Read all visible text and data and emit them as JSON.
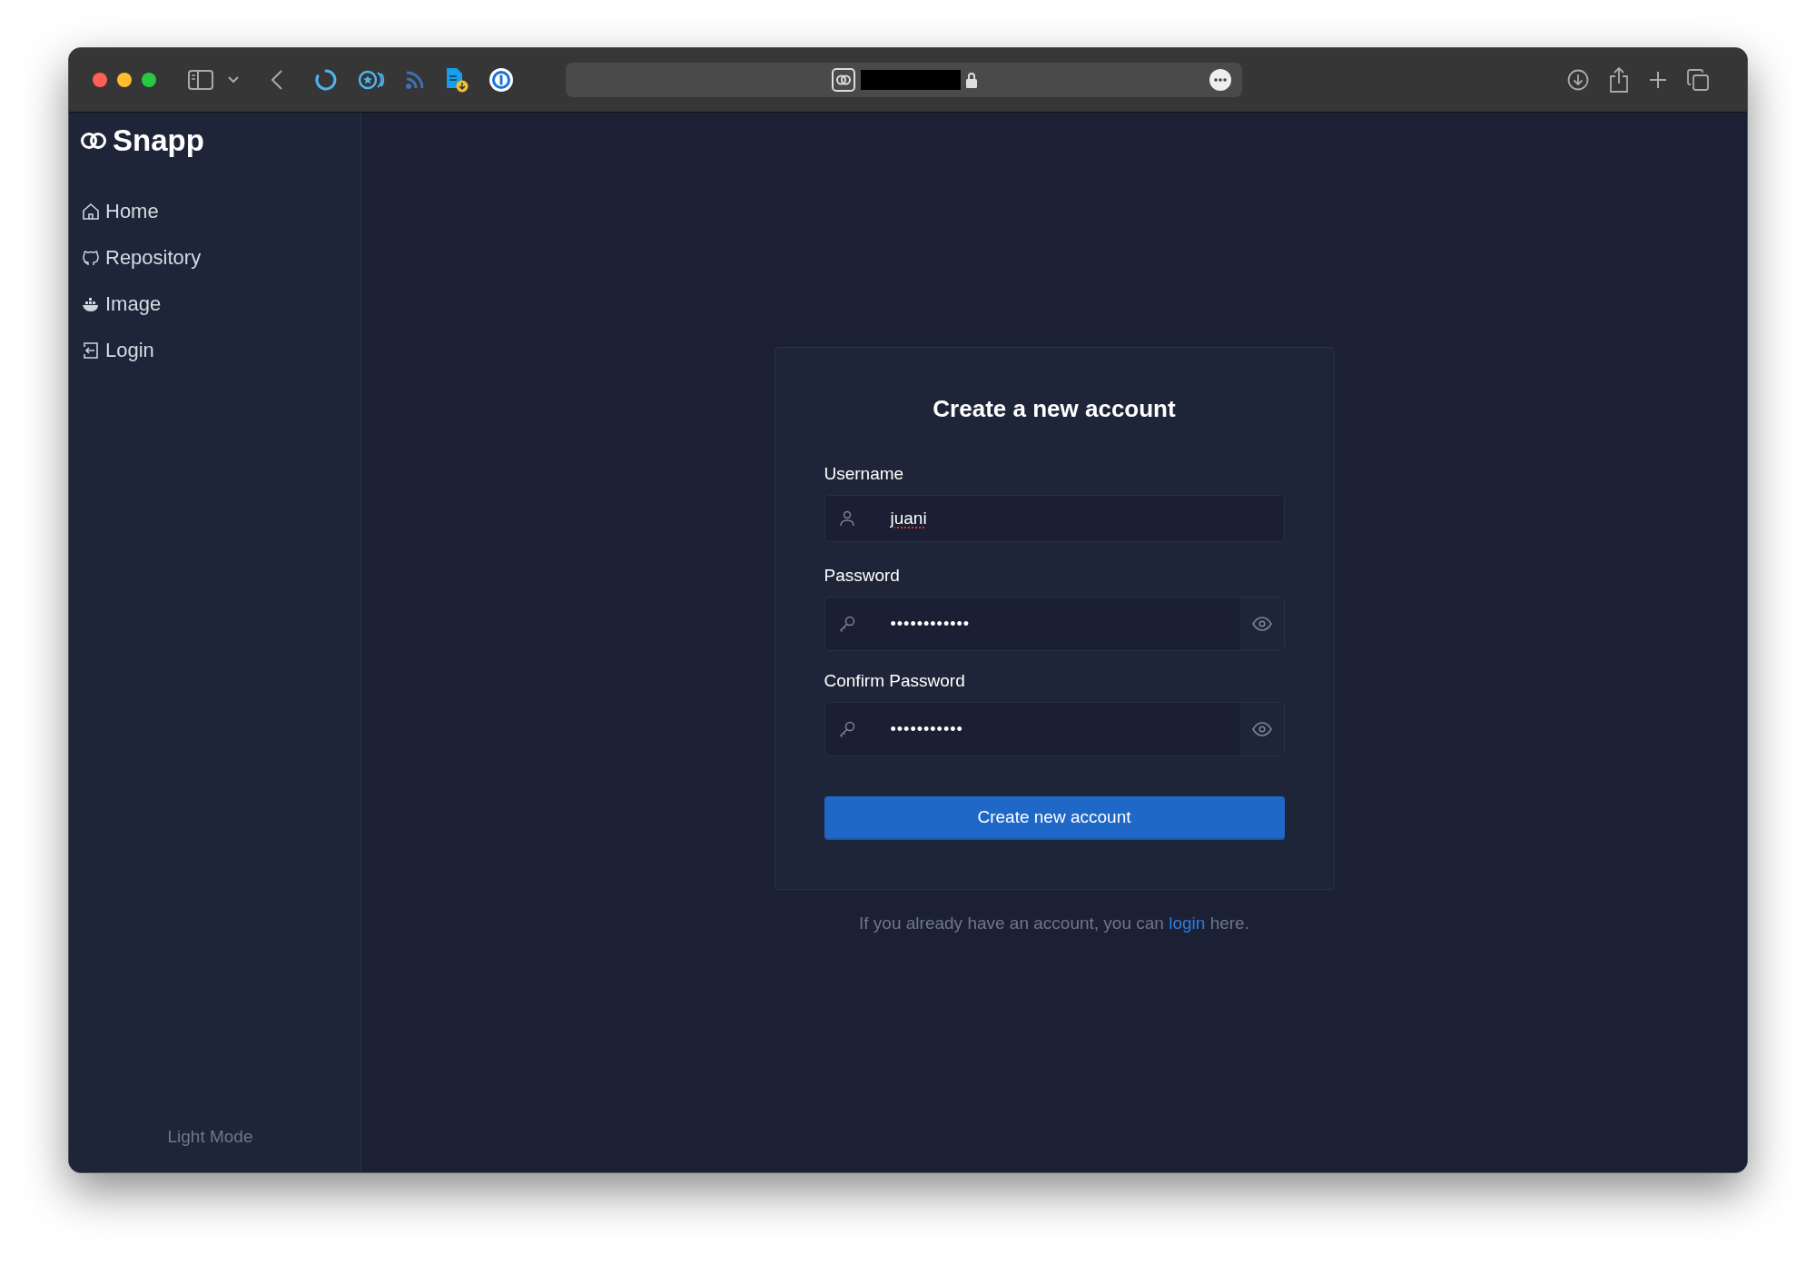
{
  "sidebar": {
    "logo": "Snapp",
    "items": [
      {
        "label": "Home"
      },
      {
        "label": "Repository"
      },
      {
        "label": "Image"
      },
      {
        "label": "Login"
      }
    ],
    "footer": "Light Mode"
  },
  "form": {
    "title": "Create a new account",
    "fields": [
      {
        "label": "Username",
        "kind": "text",
        "value": "juani"
      },
      {
        "label": "Password",
        "kind": "password",
        "value": "••••••••••••"
      },
      {
        "label": "Confirm Password",
        "kind": "password",
        "value": "•••••••••••"
      }
    ],
    "submit": "Create new account"
  },
  "login_prompt": {
    "before": "If you already have an account, you can ",
    "link": "login",
    "after": " here."
  }
}
